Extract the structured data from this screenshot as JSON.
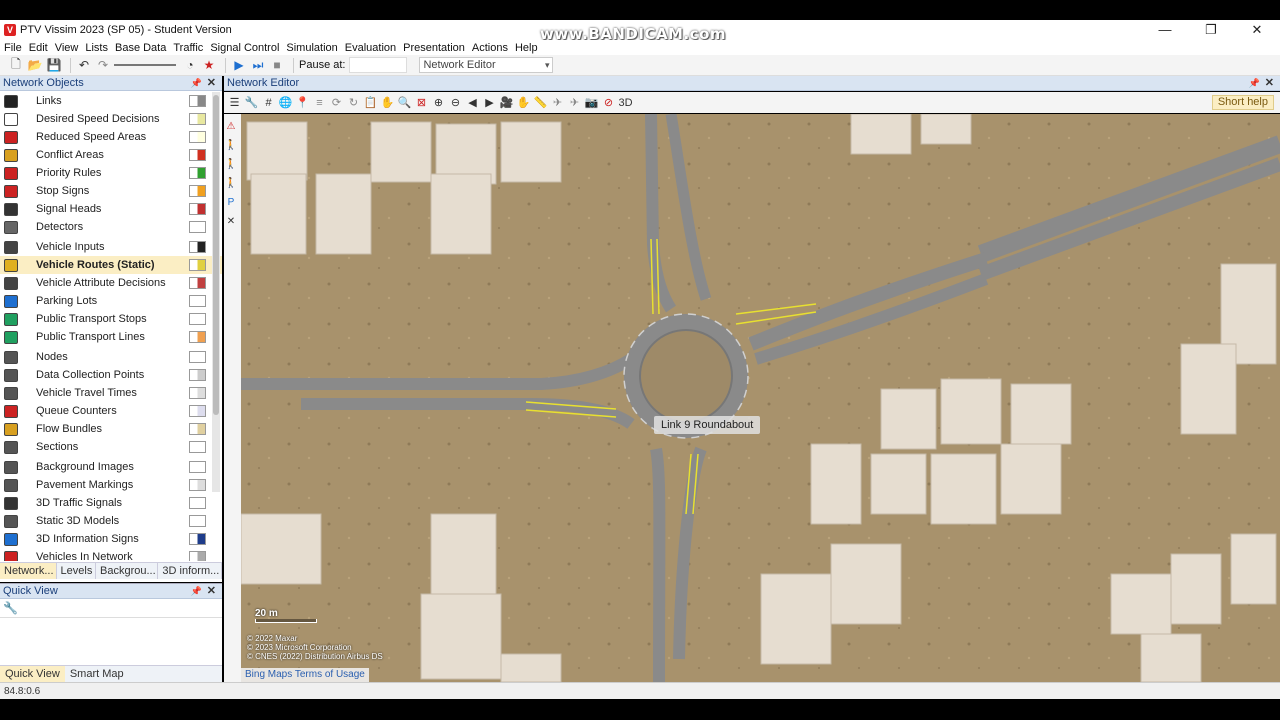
{
  "window": {
    "title": "PTV Vissim 2023 (SP 05) - Student Version",
    "watermark": "www.BANDICAM.com",
    "minimize": "—",
    "restore": "❐",
    "close": "✕"
  },
  "menu": [
    "File",
    "Edit",
    "View",
    "Lists",
    "Base Data",
    "Traffic",
    "Signal Control",
    "Simulation",
    "Evaluation",
    "Presentation",
    "Actions",
    "Help"
  ],
  "toolbar": {
    "pause_label": "Pause at:",
    "pause_value": "",
    "view_combo": "Network Editor"
  },
  "network_objects": {
    "title": "Network Objects",
    "groups": [
      [
        {
          "label": "Links",
          "icon": "links-icon",
          "color": "#222222",
          "swatch": "#888888"
        },
        {
          "label": "Desired Speed Decisions",
          "icon": "speed-50-icon",
          "color": "#ffffff",
          "swatch": "#e8e8a0"
        },
        {
          "label": "Reduced Speed Areas",
          "icon": "warning-triangle-icon",
          "color": "#cc2222",
          "swatch": "#ffffe0"
        },
        {
          "label": "Conflict Areas",
          "icon": "conflict-icon",
          "color": "#d8a020",
          "swatch": "#d03020"
        },
        {
          "label": "Priority Rules",
          "icon": "yield-icon",
          "color": "#cc2222",
          "swatch": "#30a030"
        },
        {
          "label": "Stop Signs",
          "icon": "stop-sign-icon",
          "color": "#cc2222",
          "swatch": "#f0a020"
        },
        {
          "label": "Signal Heads",
          "icon": "traffic-light-icon",
          "color": "#333333",
          "swatch": "#c03030"
        },
        {
          "label": "Detectors",
          "icon": "detector-icon",
          "color": "#666666",
          "swatch": "#ffffff"
        }
      ],
      [
        {
          "label": "Vehicle Inputs",
          "icon": "vehicle-input-icon",
          "color": "#444444",
          "swatch": "#222222"
        },
        {
          "label": "Vehicle Routes (Static)",
          "icon": "route-icon",
          "color": "#e0b020",
          "swatch": "#e0d040",
          "selected": true
        },
        {
          "label": "Vehicle Attribute Decisions",
          "icon": "attribute-decision-icon",
          "color": "#444444",
          "swatch": "#c04040"
        },
        {
          "label": "Parking Lots",
          "icon": "parking-icon",
          "color": "#1e6fd0",
          "swatch": "#ffffff"
        },
        {
          "label": "Public Transport Stops",
          "icon": "pt-stop-icon",
          "color": "#20a060",
          "swatch": "#ffffff"
        },
        {
          "label": "Public Transport Lines",
          "icon": "pt-line-icon",
          "color": "#20a060",
          "swatch": "#f0a050"
        }
      ],
      [
        {
          "label": "Nodes",
          "icon": "node-icon",
          "color": "#555555",
          "swatch": "#ffffff"
        },
        {
          "label": "Data Collection Points",
          "icon": "data-collection-icon",
          "color": "#555555",
          "swatch": "#cccccc"
        },
        {
          "label": "Vehicle Travel Times",
          "icon": "travel-time-icon",
          "color": "#555555",
          "swatch": "#dddddd"
        },
        {
          "label": "Queue Counters",
          "icon": "queue-counter-icon",
          "color": "#cc2222",
          "swatch": "#ddddee"
        },
        {
          "label": "Flow Bundles",
          "icon": "flow-bundle-icon",
          "color": "#d8a020",
          "swatch": "#e0d0a0"
        },
        {
          "label": "Sections",
          "icon": "section-icon",
          "color": "#555555",
          "swatch": "#ffffff"
        }
      ],
      [
        {
          "label": "Background Images",
          "icon": "background-image-icon",
          "color": "#555555",
          "swatch": "#ffffff"
        },
        {
          "label": "Pavement Markings",
          "icon": "pavement-marking-icon",
          "color": "#555555",
          "swatch": "#dddddd"
        },
        {
          "label": "3D Traffic Signals",
          "icon": "3d-signal-icon",
          "color": "#333333",
          "swatch": "#ffffff"
        },
        {
          "label": "Static 3D Models",
          "icon": "3d-model-icon",
          "color": "#555555",
          "swatch": "#ffffff"
        },
        {
          "label": "3D Information Signs",
          "icon": "info-sign-icon",
          "color": "#1e6fd0",
          "swatch": "#1e3c8a"
        },
        {
          "label": "Vehicles In Network",
          "icon": "vehicles-icon",
          "color": "#cc2222",
          "swatch": "#aaaaaa"
        }
      ]
    ],
    "tabs": [
      "Network...",
      "Levels",
      "Backgrou...",
      "3D inform..."
    ]
  },
  "quick_view": {
    "title": "Quick View",
    "tabs": [
      "Quick View",
      "Smart Map"
    ]
  },
  "editor": {
    "title": "Network Editor",
    "short_help": "Short help",
    "tooltip": "Link    9  Roundabout",
    "scale": "20 m",
    "copyright": [
      "© 2022 Maxar",
      "© 2023 Microsoft Corporation",
      "© CNES (2022) Distribution Airbus DS"
    ],
    "bing_terms": "Bing Maps Terms of Usage"
  },
  "status": {
    "text": "84.8:0.6"
  },
  "colors": {
    "pane_header": "#d9e4f2",
    "selected_row": "#fbeec4",
    "road": "#8c8c8c",
    "route_highlight": "#e8e030"
  }
}
